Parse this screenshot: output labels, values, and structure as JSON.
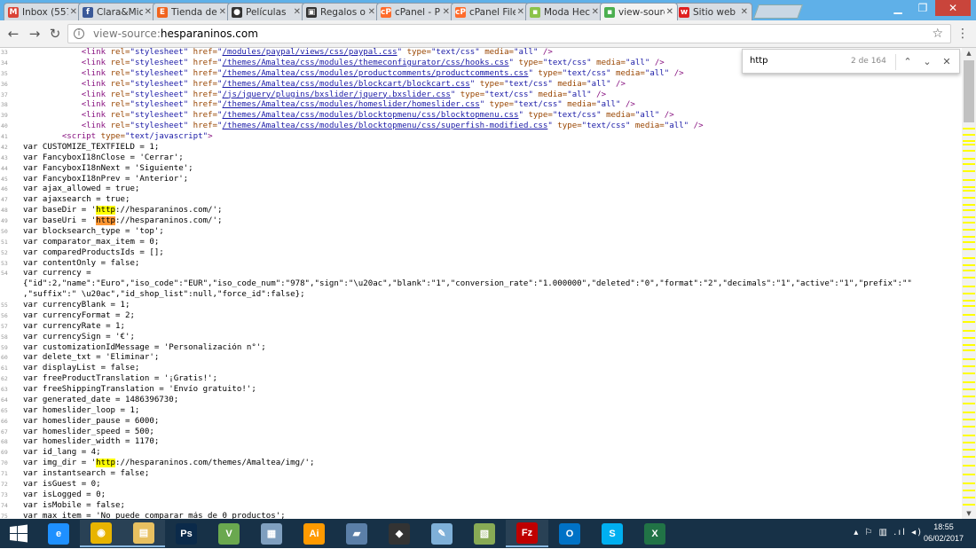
{
  "tabs": [
    {
      "title": "Inbox (557",
      "icon": "gmail-icon",
      "fav_text": "M",
      "color": "#db4437"
    },
    {
      "title": "Clara&Mic",
      "icon": "facebook-icon",
      "fav_text": "f",
      "color": "#3b5998"
    },
    {
      "title": "Tienda de",
      "icon": "etsy-icon",
      "fav_text": "E",
      "color": "#f1641e"
    },
    {
      "title": "Películas",
      "icon": "film-icon",
      "fav_text": "●",
      "color": "#333333"
    },
    {
      "title": "Regalos o",
      "icon": "gift-icon",
      "fav_text": "▣",
      "color": "#333333"
    },
    {
      "title": "cPanel - P",
      "icon": "cpanel-icon",
      "fav_text": "cP",
      "color": "#ff6c2c"
    },
    {
      "title": "cPanel File",
      "icon": "cpanel-icon",
      "fav_text": "cP",
      "color": "#ff6c2c"
    },
    {
      "title": "Moda Hec",
      "icon": "shop-icon",
      "fav_text": "▪",
      "color": "#8bc34a"
    },
    {
      "title": "view-sourc",
      "icon": "shop-icon",
      "fav_text": "▪",
      "color": "#4caf50",
      "active": true
    },
    {
      "title": "Sitio web",
      "icon": "wix-icon",
      "fav_text": "w",
      "color": "#e02020"
    }
  ],
  "address": {
    "scheme": "view-source:",
    "host": "hesparaninos.com"
  },
  "find": {
    "query": "http",
    "count": "2 de 164"
  },
  "source_lines": [
    {
      "n": "33",
      "s": [
        [
          "            ",
          ""
        ],
        [
          "<link ",
          "tag"
        ],
        [
          "rel=",
          "attr"
        ],
        [
          "\"stylesheet\" ",
          "val"
        ],
        [
          "href=",
          "attr"
        ],
        [
          "\"",
          "val"
        ],
        [
          "/modules/paypal/views/css/paypal.css",
          "link"
        ],
        [
          "\" ",
          "val"
        ],
        [
          "type=",
          "attr"
        ],
        [
          "\"text/css\" ",
          "val"
        ],
        [
          "media=",
          "attr"
        ],
        [
          "\"all\"",
          "val"
        ],
        [
          " />",
          "tag"
        ]
      ]
    },
    {
      "n": "34",
      "s": [
        [
          "            ",
          ""
        ],
        [
          "<link ",
          "tag"
        ],
        [
          "rel=",
          "attr"
        ],
        [
          "\"stylesheet\" ",
          "val"
        ],
        [
          "href=",
          "attr"
        ],
        [
          "\"",
          "val"
        ],
        [
          "/themes/Amaltea/css/modules/themeconfigurator/css/hooks.css",
          "link"
        ],
        [
          "\" ",
          "val"
        ],
        [
          "type=",
          "attr"
        ],
        [
          "\"text/css\" ",
          "val"
        ],
        [
          "media=",
          "attr"
        ],
        [
          "\"all\"",
          "val"
        ],
        [
          " />",
          "tag"
        ]
      ]
    },
    {
      "n": "35",
      "s": [
        [
          "            ",
          ""
        ],
        [
          "<link ",
          "tag"
        ],
        [
          "rel=",
          "attr"
        ],
        [
          "\"stylesheet\" ",
          "val"
        ],
        [
          "href=",
          "attr"
        ],
        [
          "\"",
          "val"
        ],
        [
          "/themes/Amaltea/css/modules/productcomments/productcomments.css",
          "link"
        ],
        [
          "\" ",
          "val"
        ],
        [
          "type=",
          "attr"
        ],
        [
          "\"text/css\" ",
          "val"
        ],
        [
          "media=",
          "attr"
        ],
        [
          "\"all\"",
          "val"
        ],
        [
          " />",
          "tag"
        ]
      ]
    },
    {
      "n": "36",
      "s": [
        [
          "            ",
          ""
        ],
        [
          "<link ",
          "tag"
        ],
        [
          "rel=",
          "attr"
        ],
        [
          "\"stylesheet\" ",
          "val"
        ],
        [
          "href=",
          "attr"
        ],
        [
          "\"",
          "val"
        ],
        [
          "/themes/Amaltea/css/modules/blockcart/blockcart.css",
          "link"
        ],
        [
          "\" ",
          "val"
        ],
        [
          "type=",
          "attr"
        ],
        [
          "\"text/css\" ",
          "val"
        ],
        [
          "media=",
          "attr"
        ],
        [
          "\"all\"",
          "val"
        ],
        [
          " />",
          "tag"
        ]
      ]
    },
    {
      "n": "37",
      "s": [
        [
          "            ",
          ""
        ],
        [
          "<link ",
          "tag"
        ],
        [
          "rel=",
          "attr"
        ],
        [
          "\"stylesheet\" ",
          "val"
        ],
        [
          "href=",
          "attr"
        ],
        [
          "\"",
          "val"
        ],
        [
          "/js/jquery/plugins/bxslider/jquery.bxslider.css",
          "link"
        ],
        [
          "\" ",
          "val"
        ],
        [
          "type=",
          "attr"
        ],
        [
          "\"text/css\" ",
          "val"
        ],
        [
          "media=",
          "attr"
        ],
        [
          "\"all\"",
          "val"
        ],
        [
          " />",
          "tag"
        ]
      ]
    },
    {
      "n": "38",
      "s": [
        [
          "            ",
          ""
        ],
        [
          "<link ",
          "tag"
        ],
        [
          "rel=",
          "attr"
        ],
        [
          "\"stylesheet\" ",
          "val"
        ],
        [
          "href=",
          "attr"
        ],
        [
          "\"",
          "val"
        ],
        [
          "/themes/Amaltea/css/modules/homeslider/homeslider.css",
          "link"
        ],
        [
          "\" ",
          "val"
        ],
        [
          "type=",
          "attr"
        ],
        [
          "\"text/css\" ",
          "val"
        ],
        [
          "media=",
          "attr"
        ],
        [
          "\"all\"",
          "val"
        ],
        [
          " />",
          "tag"
        ]
      ]
    },
    {
      "n": "39",
      "s": [
        [
          "            ",
          ""
        ],
        [
          "<link ",
          "tag"
        ],
        [
          "rel=",
          "attr"
        ],
        [
          "\"stylesheet\" ",
          "val"
        ],
        [
          "href=",
          "attr"
        ],
        [
          "\"",
          "val"
        ],
        [
          "/themes/Amaltea/css/modules/blocktopmenu/css/blocktopmenu.css",
          "link"
        ],
        [
          "\" ",
          "val"
        ],
        [
          "type=",
          "attr"
        ],
        [
          "\"text/css\" ",
          "val"
        ],
        [
          "media=",
          "attr"
        ],
        [
          "\"all\"",
          "val"
        ],
        [
          " />",
          "tag"
        ]
      ]
    },
    {
      "n": "40",
      "s": [
        [
          "            ",
          ""
        ],
        [
          "<link ",
          "tag"
        ],
        [
          "rel=",
          "attr"
        ],
        [
          "\"stylesheet\" ",
          "val"
        ],
        [
          "href=",
          "attr"
        ],
        [
          "\"",
          "val"
        ],
        [
          "/themes/Amaltea/css/modules/blocktopmenu/css/superfish-modified.css",
          "link"
        ],
        [
          "\" ",
          "val"
        ],
        [
          "type=",
          "attr"
        ],
        [
          "\"text/css\" ",
          "val"
        ],
        [
          "media=",
          "attr"
        ],
        [
          "\"all\"",
          "val"
        ],
        [
          " />",
          "tag"
        ]
      ]
    },
    {
      "n": "41",
      "s": [
        [
          "        ",
          ""
        ],
        [
          "<script ",
          "tag"
        ],
        [
          "type=",
          "attr"
        ],
        [
          "\"text/javascript\"",
          "val"
        ],
        [
          ">",
          "tag"
        ]
      ]
    },
    {
      "n": "42",
      "s": [
        [
          "var CUSTOMIZE_TEXTFIELD = 1;",
          ""
        ]
      ]
    },
    {
      "n": "43",
      "s": [
        [
          "var FancyboxI18nClose = 'Cerrar';",
          ""
        ]
      ]
    },
    {
      "n": "44",
      "s": [
        [
          "var FancyboxI18nNext = 'Siguiente';",
          ""
        ]
      ]
    },
    {
      "n": "45",
      "s": [
        [
          "var FancyboxI18nPrev = 'Anterior';",
          ""
        ]
      ]
    },
    {
      "n": "46",
      "s": [
        [
          "var ajax_allowed = true;",
          ""
        ]
      ]
    },
    {
      "n": "47",
      "s": [
        [
          "var ajaxsearch = true;",
          ""
        ]
      ]
    },
    {
      "n": "48",
      "s": [
        [
          "var baseDir = '",
          ""
        ],
        [
          "http",
          "hl"
        ],
        [
          "://hesparaninos.com/';",
          ""
        ]
      ]
    },
    {
      "n": "49",
      "s": [
        [
          "var baseUri = '",
          ""
        ],
        [
          "http",
          "hlc"
        ],
        [
          "://hesparaninos.com/';",
          ""
        ]
      ]
    },
    {
      "n": "50",
      "s": [
        [
          "var blocksearch_type = 'top';",
          ""
        ]
      ]
    },
    {
      "n": "51",
      "s": [
        [
          "var comparator_max_item = 0;",
          ""
        ]
      ]
    },
    {
      "n": "52",
      "s": [
        [
          "var comparedProductsIds = [];",
          ""
        ]
      ]
    },
    {
      "n": "53",
      "s": [
        [
          "var contentOnly = false;",
          ""
        ]
      ]
    },
    {
      "n": "54",
      "s": [
        [
          "var currency =",
          ""
        ]
      ]
    },
    {
      "n": "",
      "s": [
        [
          "{\"id\":2,\"name\":\"Euro\",\"iso_code\":\"EUR\",\"iso_code_num\":\"978\",\"sign\":\"\\u20ac\",\"blank\":\"1\",\"conversion_rate\":\"1.000000\",\"deleted\":\"0\",\"format\":\"2\",\"decimals\":\"1\",\"active\":\"1\",\"prefix\":\"\"",
          ""
        ]
      ]
    },
    {
      "n": "",
      "s": [
        [
          ",\"suffix\":\" \\u20ac\",\"id_shop_list\":null,\"force_id\":false};",
          ""
        ]
      ]
    },
    {
      "n": "55",
      "s": [
        [
          "var currencyBlank = 1;",
          ""
        ]
      ]
    },
    {
      "n": "56",
      "s": [
        [
          "var currencyFormat = 2;",
          ""
        ]
      ]
    },
    {
      "n": "57",
      "s": [
        [
          "var currencyRate = 1;",
          ""
        ]
      ]
    },
    {
      "n": "58",
      "s": [
        [
          "var currencySign = '€';",
          ""
        ]
      ]
    },
    {
      "n": "59",
      "s": [
        [
          "var customizationIdMessage = 'Personalización n°';",
          ""
        ]
      ]
    },
    {
      "n": "60",
      "s": [
        [
          "var delete_txt = 'Eliminar';",
          ""
        ]
      ]
    },
    {
      "n": "61",
      "s": [
        [
          "var displayList = false;",
          ""
        ]
      ]
    },
    {
      "n": "62",
      "s": [
        [
          "var freeProductTranslation = '¡Gratis!';",
          ""
        ]
      ]
    },
    {
      "n": "63",
      "s": [
        [
          "var freeShippingTranslation = 'Envío gratuito!';",
          ""
        ]
      ]
    },
    {
      "n": "64",
      "s": [
        [
          "var generated_date = 1486396730;",
          ""
        ]
      ]
    },
    {
      "n": "65",
      "s": [
        [
          "var homeslider_loop = 1;",
          ""
        ]
      ]
    },
    {
      "n": "66",
      "s": [
        [
          "var homeslider_pause = 6000;",
          ""
        ]
      ]
    },
    {
      "n": "67",
      "s": [
        [
          "var homeslider_speed = 500;",
          ""
        ]
      ]
    },
    {
      "n": "68",
      "s": [
        [
          "var homeslider_width = 1170;",
          ""
        ]
      ]
    },
    {
      "n": "69",
      "s": [
        [
          "var id_lang = 4;",
          ""
        ]
      ]
    },
    {
      "n": "70",
      "s": [
        [
          "var img_dir = '",
          ""
        ],
        [
          "http",
          "hl"
        ],
        [
          "://hesparaninos.com/themes/Amaltea/img/';",
          ""
        ]
      ]
    },
    {
      "n": "71",
      "s": [
        [
          "var instantsearch = false;",
          ""
        ]
      ]
    },
    {
      "n": "72",
      "s": [
        [
          "var isGuest = 0;",
          ""
        ]
      ]
    },
    {
      "n": "73",
      "s": [
        [
          "var isLogged = 0;",
          ""
        ]
      ]
    },
    {
      "n": "74",
      "s": [
        [
          "var isMobile = false;",
          ""
        ]
      ]
    },
    {
      "n": "75",
      "s": [
        [
          "var max_item = 'No puede comparar más de 0 productos';",
          ""
        ]
      ]
    }
  ],
  "taskbar": {
    "apps": [
      {
        "name": "ie-icon",
        "label": "e",
        "color": "#1e90ff"
      },
      {
        "name": "chrome-icon",
        "label": "◉",
        "color": "#e8b400",
        "open": true
      },
      {
        "name": "file-explorer-icon",
        "label": "▤",
        "color": "#e8c060",
        "open": true
      },
      {
        "name": "photoshop-icon",
        "label": "Ps",
        "color": "#0b2a4a"
      },
      {
        "name": "vectorworks-icon",
        "label": "V",
        "color": "#6aa84f"
      },
      {
        "name": "calculator-icon",
        "label": "▦",
        "color": "#7f9fbf"
      },
      {
        "name": "illustrator-icon",
        "label": "Ai",
        "color": "#ff9a00"
      },
      {
        "name": "notebook-icon",
        "label": "▰",
        "color": "#5b7fa8"
      },
      {
        "name": "inkscape-icon",
        "label": "◆",
        "color": "#333333"
      },
      {
        "name": "paint-icon",
        "label": "✎",
        "color": "#7fb0d8"
      },
      {
        "name": "image-editor-icon",
        "label": "▧",
        "color": "#88aa55"
      },
      {
        "name": "filezilla-icon",
        "label": "Fz",
        "color": "#bf0000",
        "open": true
      },
      {
        "name": "outlook-icon",
        "label": "O",
        "color": "#0072c6"
      },
      {
        "name": "skype-icon",
        "label": "S",
        "color": "#00aff0"
      },
      {
        "name": "excel-icon",
        "label": "X",
        "color": "#217346"
      }
    ],
    "tray": "▴  ⚐  ▥  .ıl  ◂)",
    "time": "18:55",
    "date": "06/02/2017"
  }
}
